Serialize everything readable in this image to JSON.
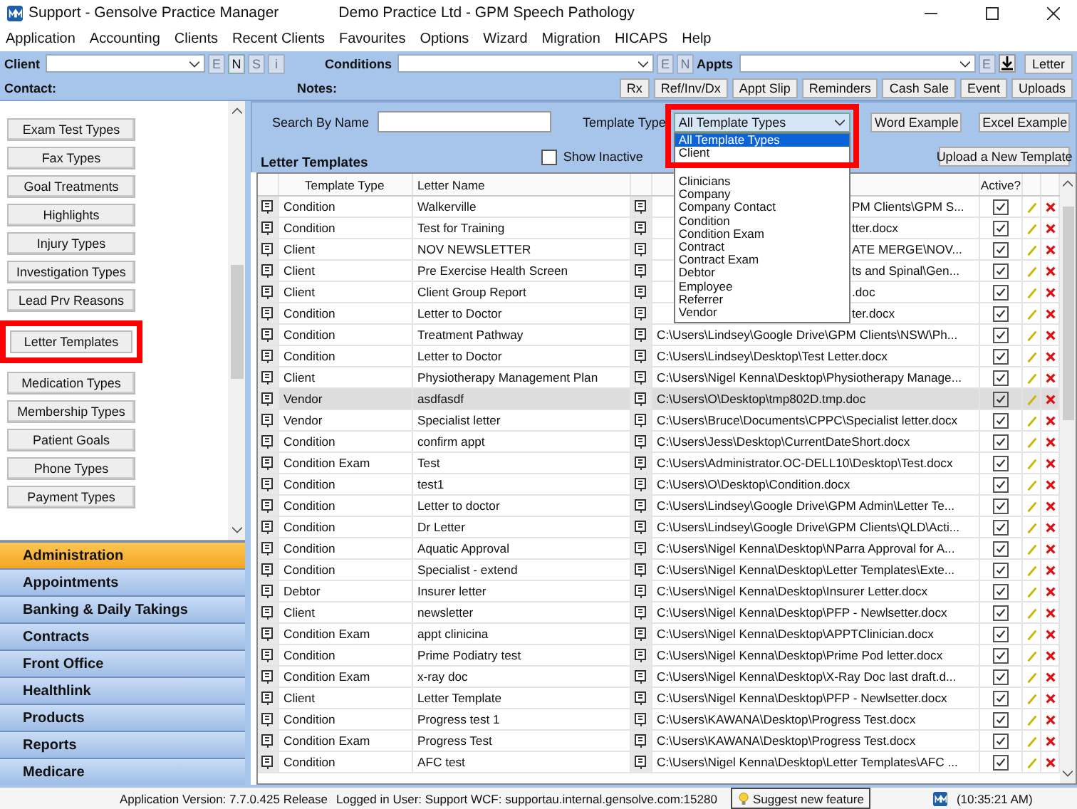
{
  "title_bar": {
    "app_title": "Support - Gensolve Practice Manager",
    "practice": "Demo Practice Ltd - GPM Speech Pathology"
  },
  "menu": [
    "Application",
    "Accounting",
    "Clients",
    "Recent Clients",
    "Favourites",
    "Options",
    "Wizard",
    "Migration",
    "HICAPS",
    "Help"
  ],
  "toolbar": {
    "client_label": "Client",
    "conditions_label": "Conditions",
    "appts_label": "Appts",
    "contact_label": "Contact:",
    "notes_label": "Notes:",
    "letter_button": "Letter",
    "client_keys": [
      {
        "label": "E",
        "disabled": true
      },
      {
        "label": "N",
        "disabled": false
      },
      {
        "label": "S",
        "disabled": true
      },
      {
        "label": "i",
        "disabled": true
      }
    ],
    "condition_keys": [
      {
        "label": "E",
        "disabled": true
      },
      {
        "label": "N",
        "disabled": true
      }
    ],
    "appt_keys": [
      {
        "label": "E",
        "disabled": true
      }
    ],
    "buttons": [
      "Rx",
      "Ref/Inv/Dx",
      "Appt Slip",
      "Reminders",
      "Cash Sale",
      "Event",
      "Uploads"
    ]
  },
  "sidebar": {
    "settings": [
      {
        "label": "Exam Test Types",
        "highlighted": false
      },
      {
        "label": "Fax Types",
        "highlighted": false
      },
      {
        "label": "Goal Treatments",
        "highlighted": false
      },
      {
        "label": "Highlights",
        "highlighted": false
      },
      {
        "label": "Injury Types",
        "highlighted": false
      },
      {
        "label": "Investigation Types",
        "highlighted": false
      },
      {
        "label": "Lead Prv Reasons",
        "highlighted": false
      },
      {
        "label": "Letter Templates",
        "highlighted": true
      },
      {
        "label": "Medication Types",
        "highlighted": false
      },
      {
        "label": "Membership Types",
        "highlighted": false
      },
      {
        "label": "Patient Goals",
        "highlighted": false
      },
      {
        "label": "Phone Types",
        "highlighted": false
      },
      {
        "label": "Payment Types",
        "highlighted": false
      }
    ],
    "modules": [
      {
        "label": "Administration",
        "selected": true
      },
      {
        "label": "Appointments",
        "selected": false
      },
      {
        "label": "Banking & Daily Takings",
        "selected": false
      },
      {
        "label": "Contracts",
        "selected": false
      },
      {
        "label": "Front Office",
        "selected": false
      },
      {
        "label": "Healthlink",
        "selected": false
      },
      {
        "label": "Products",
        "selected": false
      },
      {
        "label": "Reports",
        "selected": false
      },
      {
        "label": "Medicare",
        "selected": false
      }
    ]
  },
  "main": {
    "search_label": "Search By Name",
    "template_type_label": "Template Type",
    "template_type": {
      "value": "All Template Types",
      "highlighted": true,
      "expanded": true,
      "options": [
        {
          "label": "All Template Types",
          "selected": true
        },
        {
          "label": "Client",
          "selected": false
        },
        {
          "label": "Clinicians",
          "selected": false
        },
        {
          "label": "Company",
          "selected": false
        },
        {
          "label": "Company Contact",
          "selected": false
        },
        {
          "label": "Condition",
          "selected": false
        },
        {
          "label": "Condition Exam",
          "selected": false
        },
        {
          "label": "Contract",
          "selected": false
        },
        {
          "label": "Contract Exam",
          "selected": false
        },
        {
          "label": "Debtor",
          "selected": false
        },
        {
          "label": "Employee",
          "selected": false
        },
        {
          "label": "Referrer",
          "selected": false
        },
        {
          "label": "Vendor",
          "selected": false
        }
      ]
    },
    "word_example": "Word Example",
    "excel_example": "Excel Example",
    "show_inactive": {
      "label": "Show Inactive",
      "checked": false
    },
    "upload_button": "Upload a New Template",
    "section_title": "Letter Templates",
    "columns": [
      "Template Type",
      "Letter Name",
      "Active?"
    ],
    "rows": [
      {
        "type": "Condition",
        "name": "Walkerville",
        "path": "PM Clients\\GPM S...",
        "covered": true,
        "active": true,
        "selected": false
      },
      {
        "type": "Condition",
        "name": "Test for Training",
        "path": "tter.docx",
        "covered": true,
        "active": true,
        "selected": false
      },
      {
        "type": "Client",
        "name": "NOV NEWSLETTER",
        "path": "ATE MERGE\\NOV...",
        "covered": true,
        "active": true,
        "selected": false
      },
      {
        "type": "Client",
        "name": "Pre Exercise Health Screen",
        "path": "ts and Spinal\\Gen...",
        "covered": true,
        "active": true,
        "selected": false
      },
      {
        "type": "Client",
        "name": "Client Group Report",
        "path": ".doc",
        "covered": true,
        "active": true,
        "selected": false
      },
      {
        "type": "Condition",
        "name": "Letter to Doctor",
        "path": "ter.docx",
        "covered": true,
        "active": true,
        "selected": false
      },
      {
        "type": "Condition",
        "name": "Treatment Pathway",
        "path": "C:\\Users\\Lindsey\\Google Drive\\GPM Clients\\NSW\\Ph...",
        "active": true,
        "selected": false
      },
      {
        "type": "Condition",
        "name": "Letter to Doctor",
        "path": "C:\\Users\\Lindsey\\Desktop\\Test Letter.docx",
        "active": true,
        "selected": false
      },
      {
        "type": "Client",
        "name": "Physiotherapy Management Plan",
        "path": "C:\\Users\\Nigel Kenna\\Desktop\\Physiotherapy Manage...",
        "active": true,
        "selected": false
      },
      {
        "type": "Vendor",
        "name": "asdfasdf",
        "path": "C:\\Users\\O\\Desktop\\tmp802D.tmp.doc",
        "active": true,
        "selected": true
      },
      {
        "type": "Vendor",
        "name": "Specialist letter",
        "path": "C:\\Users\\Bruce\\Documents\\CPPC\\Specialist letter.docx",
        "active": true,
        "selected": false
      },
      {
        "type": "Condition",
        "name": "confirm appt",
        "path": "C:\\Users\\Jess\\Desktop\\CurrentDateShort.docx",
        "active": true,
        "selected": false
      },
      {
        "type": "Condition Exam",
        "name": "Test",
        "path": "C:\\Users\\Administrator.OC-DELL10\\Desktop\\Test.docx",
        "active": true,
        "selected": false
      },
      {
        "type": "Condition",
        "name": "test1",
        "path": "C:\\Users\\O\\Desktop\\Condition.docx",
        "active": true,
        "selected": false
      },
      {
        "type": "Condition",
        "name": "Letter to doctor",
        "path": "C:\\Users\\Lindsey\\Google Drive\\GPM Admin\\Letter Te...",
        "active": true,
        "selected": false
      },
      {
        "type": "Condition",
        "name": "Dr Letter",
        "path": "C:\\Users\\Lindsey\\Google Drive\\GPM Clients\\QLD\\Acti...",
        "active": true,
        "selected": false
      },
      {
        "type": "Condition",
        "name": "Aquatic Approval",
        "path": "C:\\Users\\Nigel Kenna\\Desktop\\NParra Approval for A...",
        "active": true,
        "selected": false
      },
      {
        "type": "Condition",
        "name": "Specialist - extend",
        "path": "C:\\Users\\Nigel Kenna\\Desktop\\Letter Templates\\Exte...",
        "active": true,
        "selected": false
      },
      {
        "type": "Debtor",
        "name": "Insurer letter",
        "path": "C:\\Users\\Nigel Kenna\\Desktop\\Insurer Letter.docx",
        "active": true,
        "selected": false
      },
      {
        "type": "Client",
        "name": "newsletter",
        "path": "C:\\Users\\Nigel Kenna\\Desktop\\PFP - Newlsetter.docx",
        "active": true,
        "selected": false
      },
      {
        "type": "Condition Exam",
        "name": "appt clinicina",
        "path": "C:\\Users\\Nigel Kenna\\Desktop\\APPTClinician.docx",
        "active": true,
        "selected": false
      },
      {
        "type": "Condition",
        "name": "Prime Podiatry test",
        "path": "C:\\Users\\Nigel Kenna\\Desktop\\Prime Pod letter.docx",
        "active": true,
        "selected": false
      },
      {
        "type": "Condition Exam",
        "name": "x-ray doc",
        "path": "C:\\Users\\Nigel Kenna\\Desktop\\X-Ray Doc last draft.d...",
        "active": true,
        "selected": false
      },
      {
        "type": "Client",
        "name": "Letter Template",
        "path": "C:\\Users\\Nigel Kenna\\Desktop\\PFP - Newlsetter.docx",
        "active": true,
        "selected": false
      },
      {
        "type": "Condition",
        "name": "Progress test 1",
        "path": "C:\\Users\\KAWANA\\Desktop\\Progress Test.docx",
        "active": true,
        "selected": false
      },
      {
        "type": "Condition Exam",
        "name": "Progress Test",
        "path": "C:\\Users\\KAWANA\\Desktop\\Progress Test.docx",
        "active": true,
        "selected": false
      },
      {
        "type": "Condition",
        "name": "AFC test",
        "path": "C:\\Users\\Nigel Kenna\\Desktop\\Letter Templates\\AFC ...",
        "active": true,
        "selected": false
      }
    ]
  },
  "status_bar": {
    "version": "Application Version: 7.7.0.425 Release",
    "user": "Logged in User: Support WCF: supportau.internal.gensolve.com:15280",
    "suggest": "Suggest new feature",
    "time": "(10:35:21 AM)"
  }
}
